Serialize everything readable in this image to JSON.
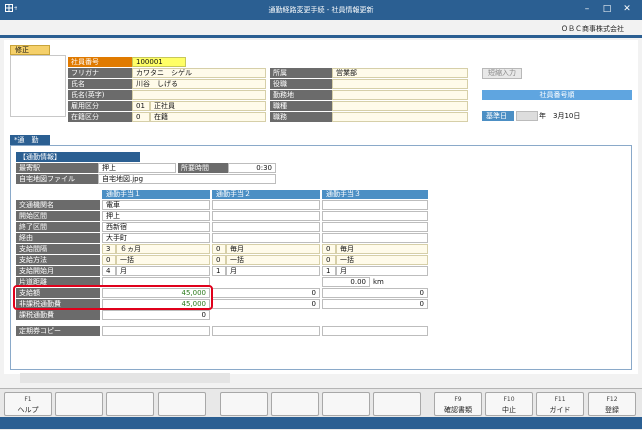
{
  "window": {
    "title": "通勤経路変更手続 - 社員情報更新",
    "app_icon": "grid-plus-icon"
  },
  "company": "ＯＢＣ商事株式会社",
  "mode_label": "修正",
  "employee": {
    "fields": [
      {
        "label": "社員番号",
        "value": "100001"
      },
      {
        "label": "フリガナ",
        "value": "カワタニ　シゲル"
      },
      {
        "label": "氏名",
        "value": "川谷　しげる"
      },
      {
        "label": "氏名(英字)",
        "value": ""
      },
      {
        "label": "雇用区分",
        "code": "01",
        "value": "正社員"
      },
      {
        "label": "在籍区分",
        "code": "0",
        "value": "在籍"
      }
    ],
    "right_fields": [
      {
        "label": "所属",
        "value": "営業部"
      },
      {
        "label": "役職",
        "value": ""
      },
      {
        "label": "勤務地",
        "value": ""
      },
      {
        "label": "職種",
        "value": ""
      },
      {
        "label": "職務",
        "value": ""
      }
    ]
  },
  "side": {
    "short_input_button": "短縮入力",
    "sort_label": "社員番号順",
    "base_date_label": "基準日",
    "base_date_value": "年　3月10日"
  },
  "tab": {
    "label": "*通　勤"
  },
  "commute_info": {
    "header": "【通勤情報】",
    "nearest_station_label": "最寄駅",
    "nearest_station_value": "押上",
    "time_label": "所要時間",
    "time_value": "0:30",
    "map_file_label": "自宅地図ファイル",
    "map_file_value": "自宅地図.jpg"
  },
  "allowance": {
    "columns": [
      "通勤手当１",
      "通勤手当２",
      "通勤手当３"
    ],
    "row_labels": {
      "transport": "交通機関名",
      "start": "開始区間",
      "end": "終了区間",
      "via": "経由",
      "period": "支給間隔",
      "method": "支給方法",
      "start_month": "支給開始月",
      "distance": "片道距離",
      "amount": "支給額",
      "nontax": "非課税通勤費",
      "taxable": "課税通勤費"
    },
    "col1": {
      "transport": "電車",
      "start": "押上",
      "end": "西新宿",
      "via": "大手町",
      "period_code": "3",
      "period_text": "６ヵ月",
      "method_code": "0",
      "method_text": "一括",
      "start_month_code": "4",
      "start_month_text": "月",
      "amount": "45,000",
      "nontax": "45,000",
      "taxable": "0"
    },
    "col2": {
      "period_code": "0",
      "period_text": "毎月",
      "method_code": "0",
      "method_text": "一括",
      "start_month_code": "1",
      "start_month_text": "月",
      "amount": "0",
      "nontax": "0"
    },
    "col3": {
      "period_code": "0",
      "period_text": "毎月",
      "method_code": "0",
      "method_text": "一括",
      "start_month_code": "1",
      "start_month_text": "月",
      "distance": "0.00",
      "distance_unit": "km",
      "amount": "0",
      "nontax": "0"
    },
    "pass_copy_label": "定期券コピー"
  },
  "highlight_color": "#e0001b",
  "fkeys": [
    {
      "key": "F1",
      "label": "ヘルプ"
    },
    {
      "key": "",
      "label": ""
    },
    {
      "key": "",
      "label": ""
    },
    {
      "key": "",
      "label": ""
    },
    {
      "key": "",
      "label": ""
    },
    {
      "key": "",
      "label": ""
    },
    {
      "key": "",
      "label": ""
    },
    {
      "key": "",
      "label": ""
    },
    {
      "key": "F9",
      "label": "確認書類"
    },
    {
      "key": "F10",
      "label": "中止"
    },
    {
      "key": "F11",
      "label": "ガイド"
    },
    {
      "key": "F12",
      "label": "登録"
    }
  ]
}
